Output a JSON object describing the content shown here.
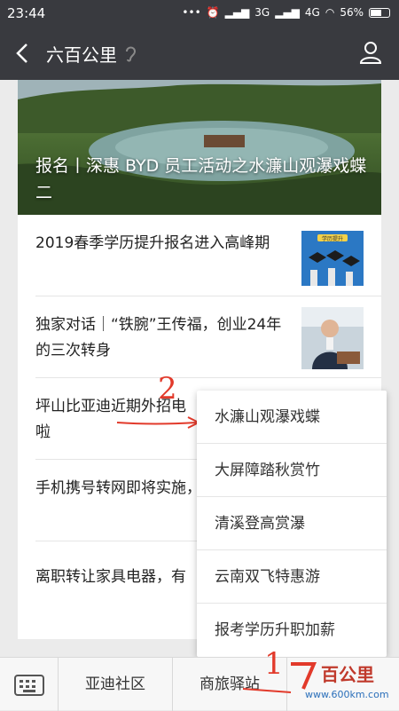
{
  "status_bar": {
    "time": "23:44",
    "network": "3G",
    "network2": "4G",
    "battery": "56%"
  },
  "header": {
    "title": "六百公里"
  },
  "hero": {
    "title": "报名丨深惠 BYD 员工活动之水濂山观瀑戏蝶二"
  },
  "articles": [
    {
      "title": "2019春季学历提升报名进入高峰期",
      "thumb_label": "学历提升"
    },
    {
      "title": "独家对话｜“铁腕”王传福，创业24年的三次转身"
    },
    {
      "title": "坪山比亚迪近期外招电"
    },
    {
      "title": "手机携号转网即将实施，弃谁?"
    },
    {
      "title": "离职转让家具电器，有"
    }
  ],
  "popup_menu": {
    "items": [
      "水濂山观瀑戏蝶",
      "大屏障踏秋赏竹",
      "清溪登高赏瀑",
      "云南双飞特惠游",
      "报考学历升职加薪"
    ]
  },
  "bottom_bar": {
    "tabs": [
      "亚迪社区",
      "商旅驿站",
      "百公里"
    ]
  },
  "annotations": {
    "one": "1",
    "two": "2"
  },
  "watermark": {
    "text": "百公里",
    "url": "www.600km.com"
  },
  "colors": {
    "bar_bg": "#393a3f",
    "annotation": "#e23a2b"
  }
}
